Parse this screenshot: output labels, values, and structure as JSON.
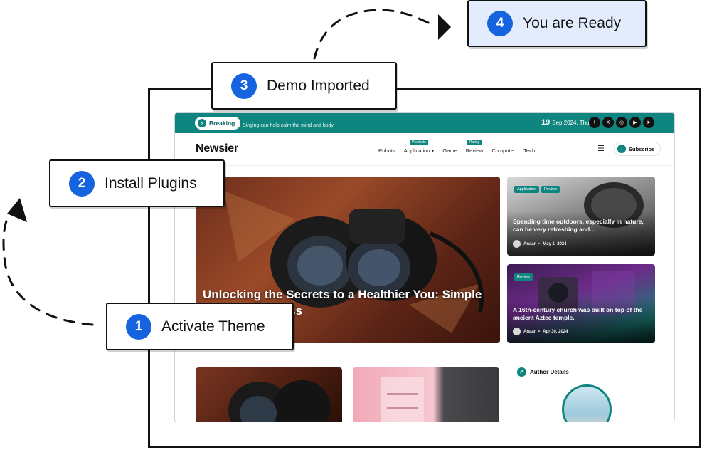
{
  "steps": [
    {
      "num": "1",
      "label": "Activate Theme"
    },
    {
      "num": "2",
      "label": "Install Plugins"
    },
    {
      "num": "3",
      "label": "Demo Imported"
    },
    {
      "num": "4",
      "label": "You are Ready"
    }
  ],
  "site": {
    "topbar": {
      "breaking_label": "Breaking",
      "ticker_text": "Singing can help calm the mind and body.",
      "date_day": "19",
      "date_rest": "Sep 2024, Thu",
      "social_icons": [
        "facebook-icon",
        "x-icon",
        "instagram-icon",
        "youtube-icon",
        "telegram-icon"
      ]
    },
    "logo": "Newsier",
    "menu": [
      {
        "label": "Robots"
      },
      {
        "label": "Application ▾",
        "tag": "Products"
      },
      {
        "label": "Game"
      },
      {
        "label": "Review",
        "tag": "Rating"
      },
      {
        "label": "Computer"
      },
      {
        "label": "Tech"
      }
    ],
    "subscribe_label": "Subscribe",
    "hero_title": "Unlocking the Secrets to a Healthier You: Simple Tips for Wellness",
    "cards": [
      {
        "tags": [
          "Application",
          "Review"
        ],
        "title": "Spending time outdoors, especially in nature, can be very refreshing and…",
        "author": "Anaar",
        "date": "May 1, 2024"
      },
      {
        "tags": [
          "Review"
        ],
        "title": "A 16th-century church was built on top of the ancient Aztec temple.",
        "author": "Anaar",
        "date": "Apr 30, 2024"
      }
    ],
    "author_heading": "Author Details"
  },
  "colors": {
    "accent": "#0f8580",
    "step_number": "#1663e0",
    "ready_bg": "#e3ecfc"
  }
}
